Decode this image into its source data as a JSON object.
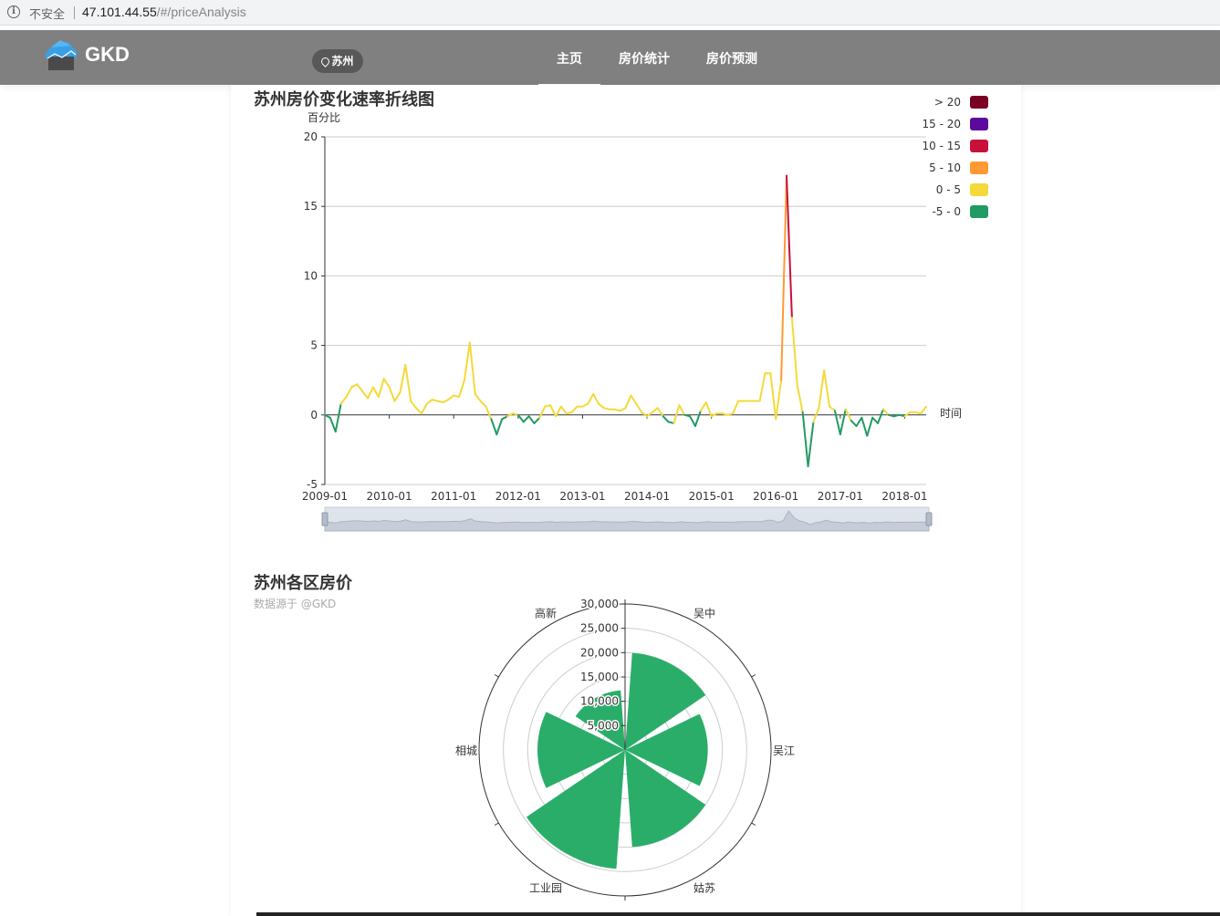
{
  "browser": {
    "security_label": "不安全",
    "url_host": "47.101.44.55",
    "url_path": "/#/priceAnalysis"
  },
  "header": {
    "brand": "GKD",
    "city": "苏州",
    "nav": [
      {
        "label": "主页",
        "active": true
      },
      {
        "label": "房价统计",
        "active": false
      },
      {
        "label": "房价预测",
        "active": false
      }
    ],
    "colors": {
      "bar": "#808080",
      "city_pill": "#585858",
      "logo": "#3aa0e6"
    }
  },
  "line_chart": {
    "title": "苏州房价变化速率折线图",
    "y_name": "百分比",
    "x_name": "时间"
  },
  "polar_chart": {
    "title": "苏州各区房价",
    "subtitle": "数据源于 @GKD"
  },
  "chart_data": [
    {
      "type": "line",
      "title": "苏州房价变化速率折线图",
      "ylabel": "百分比",
      "xlabel": "时间",
      "ylim": [
        -5,
        20
      ],
      "yticks": [
        -5,
        0,
        5,
        10,
        15,
        20
      ],
      "xticks": [
        "2009-01",
        "2010-01",
        "2011-01",
        "2012-01",
        "2013-01",
        "2014-01",
        "2015-01",
        "2016-01",
        "2017-01",
        "2018-01"
      ],
      "x_start": "2009-01",
      "x_end": "2018-05",
      "grid": true,
      "dataZoom": true,
      "legend_position": "top-right",
      "visual_map": [
        {
          "label": "> 20",
          "min": 20,
          "max": null,
          "color": "#7a0025"
        },
        {
          "label": "15 - 20",
          "min": 15,
          "max": 20,
          "color": "#5c0a9e"
        },
        {
          "label": "10 - 15",
          "min": 10,
          "max": 15,
          "color": "#c8103a"
        },
        {
          "label": "5 - 10",
          "min": 5,
          "max": 10,
          "color": "#ff9933"
        },
        {
          "label": "0 - 5",
          "min": 0,
          "max": 5,
          "color": "#f4d93a"
        },
        {
          "label": "-5 - 0",
          "min": -5,
          "max": 0,
          "color": "#229a63"
        }
      ],
      "values": [
        0.0,
        -0.2,
        -1.2,
        0.8,
        1.3,
        2.0,
        2.2,
        1.7,
        1.2,
        2.0,
        1.3,
        2.6,
        2.0,
        1.0,
        1.6,
        3.6,
        1.0,
        0.5,
        0.1,
        0.8,
        1.1,
        1.0,
        0.9,
        1.1,
        1.4,
        1.3,
        2.5,
        5.2,
        1.5,
        1.0,
        0.6,
        -0.3,
        -1.4,
        -0.3,
        -0.1,
        0.1,
        0.0,
        -0.5,
        -0.1,
        -0.6,
        -0.2,
        0.6,
        0.7,
        -0.1,
        0.6,
        0.1,
        0.2,
        0.6,
        0.6,
        0.8,
        1.5,
        0.8,
        0.5,
        0.4,
        0.4,
        0.3,
        0.5,
        1.4,
        0.8,
        0.2,
        -0.1,
        0.2,
        0.5,
        -0.1,
        -0.5,
        -0.6,
        0.7,
        0.0,
        -0.1,
        -0.8,
        0.3,
        0.9,
        -0.1,
        0.1,
        0.1,
        0.0,
        0.1,
        1.0,
        1.0,
        1.0,
        1.0,
        1.0,
        3.0,
        3.0,
        -0.3,
        2.5,
        17.2,
        7.0,
        2.1,
        0.2,
        -3.7,
        -0.5,
        0.5,
        3.2,
        0.6,
        0.3,
        -1.4,
        0.4,
        -0.4,
        -0.8,
        -0.2,
        -1.5,
        -0.2,
        -0.6,
        0.4,
        0.0,
        -0.1,
        0.0,
        -0.1,
        0.2,
        0.2,
        0.1,
        0.6
      ]
    },
    {
      "type": "bar",
      "subtype": "polar",
      "title": "苏州各区房价",
      "subtitle": "数据源于 @GKD",
      "radius_ticks": [
        0,
        5000,
        10000,
        15000,
        20000,
        25000,
        30000
      ],
      "radius_max": 30000,
      "categories": [
        "吴中",
        "吴江",
        "姑苏",
        "工业园",
        "相城",
        "高新"
      ],
      "values": [
        20000,
        17000,
        20000,
        24500,
        18000,
        12300
      ],
      "color": "#2bad6a"
    }
  ]
}
